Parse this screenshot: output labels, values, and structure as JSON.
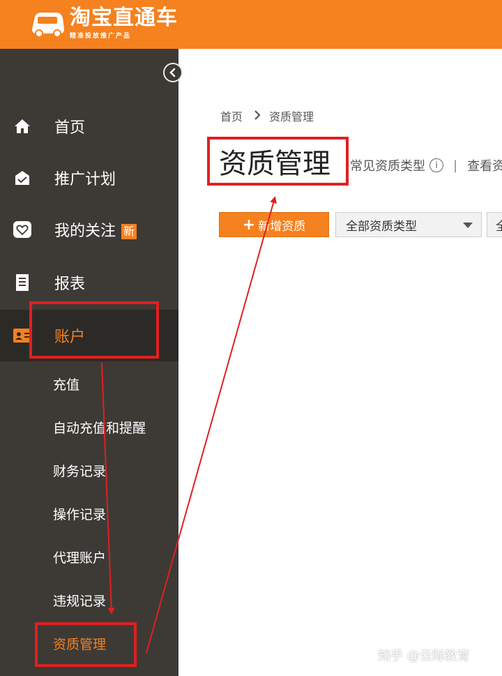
{
  "header": {
    "brand": "淘宝直通车",
    "slogan": "精准投放推广产品",
    "bg_color": "#f5811f"
  },
  "sidebar": {
    "collapse_icon": "chevron-left-circle-icon",
    "nav": [
      {
        "label": "首页",
        "icon": "home-icon"
      },
      {
        "label": "推广计划",
        "icon": "shop-bag-icon"
      },
      {
        "label": "我的关注",
        "icon": "heart-icon",
        "badge": "新"
      },
      {
        "label": "报表",
        "icon": "report-icon"
      },
      {
        "label": "账户",
        "icon": "account-card-icon",
        "active": true
      }
    ],
    "sub": [
      {
        "label": "充值"
      },
      {
        "label": "自动充值和提醒"
      },
      {
        "label": "财务记录"
      },
      {
        "label": "操作记录"
      },
      {
        "label": "代理账户"
      },
      {
        "label": "违规记录"
      },
      {
        "label": "资质管理",
        "active": true
      }
    ]
  },
  "main": {
    "breadcrumb": {
      "home": "首页",
      "current": "资质管理"
    },
    "title": "资质管理",
    "links": {
      "common_types": "常见资质类型",
      "view": "查看资"
    },
    "toolbar": {
      "add_label": "新增资质",
      "type_filter_value": "全部资质类型",
      "second_filter_value": "全"
    }
  },
  "watermark": "知乎 @云际教育",
  "annotation_color": "#e02020"
}
